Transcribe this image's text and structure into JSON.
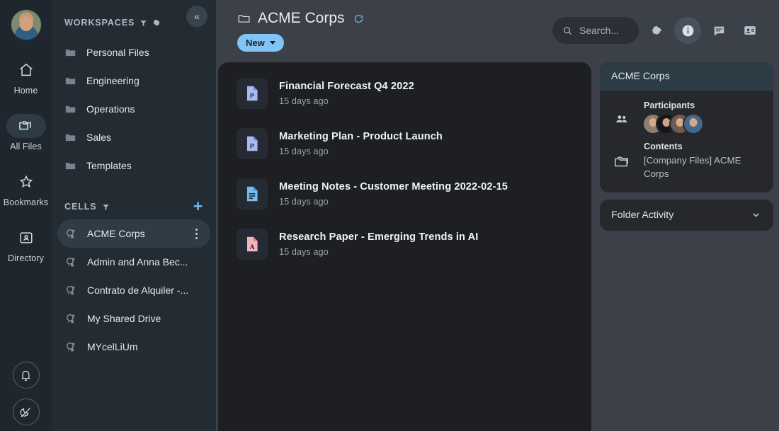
{
  "rail": {
    "avatar_name": "user-avatar",
    "items": [
      {
        "label": "Home",
        "icon": "home-icon"
      },
      {
        "label": "All Files",
        "icon": "files-icon",
        "active": true
      },
      {
        "label": "Bookmarks",
        "icon": "star-icon"
      },
      {
        "label": "Directory",
        "icon": "contact-card-icon"
      }
    ],
    "bottom": [
      {
        "name": "notifications-button",
        "icon": "bell-icon"
      },
      {
        "name": "theme-toggle-button",
        "icon": "magic-wand-icon"
      }
    ]
  },
  "sidebar": {
    "collapse_label": "«",
    "workspaces": {
      "title": "WORKSPACES",
      "filter_icon": "filter-icon",
      "settings_icon": "gear-icon",
      "items": [
        {
          "label": "Personal Files",
          "icon": "personal-folder-icon"
        },
        {
          "label": "Engineering",
          "icon": "folder-icon"
        },
        {
          "label": "Operations",
          "icon": "folder-icon"
        },
        {
          "label": "Sales",
          "icon": "folder-icon"
        },
        {
          "label": "Templates",
          "icon": "folder-icon"
        }
      ]
    },
    "cells": {
      "title": "CELLS",
      "filter_icon": "filter-icon",
      "add_label": "+",
      "items": [
        {
          "label": "ACME Corps",
          "selected": true
        },
        {
          "label": "Admin and Anna Bec..."
        },
        {
          "label": "Contrato de Alquiler -..."
        },
        {
          "label": "My Shared Drive"
        },
        {
          "label": "MYcelLiUm"
        }
      ]
    }
  },
  "header": {
    "folder_icon": "folder-icon",
    "title": "ACME Corps",
    "refresh_icon": "refresh-icon",
    "new_button": "New",
    "search": {
      "placeholder": "Search...",
      "value": "",
      "icon": "search-icon"
    },
    "tools": [
      {
        "name": "settings-button",
        "icon": "gear-icon",
        "active": false
      },
      {
        "name": "info-button",
        "icon": "info-icon",
        "active": true
      },
      {
        "name": "chat-button",
        "icon": "chat-icon",
        "active": false
      },
      {
        "name": "contacts-button",
        "icon": "contact-card-icon",
        "active": false
      }
    ]
  },
  "files": [
    {
      "title": "Financial Forecast Q4 2022",
      "modified": "15 days ago",
      "type": "ppt",
      "color": "#aab9f0"
    },
    {
      "title": "Marketing Plan - Product Launch",
      "modified": "15 days ago",
      "type": "ppt",
      "color": "#aab9f0"
    },
    {
      "title": "Meeting Notes - Customer Meeting 2022-02-15",
      "modified": "15 days ago",
      "type": "doc",
      "color": "#77bdf0"
    },
    {
      "title": "Research Paper - Emerging Trends in AI",
      "modified": "15 days ago",
      "type": "pdf",
      "color": "#f2b3bd"
    }
  ],
  "info_panel": {
    "card_title": "ACME Corps",
    "participants_label": "Participants",
    "participants_icon": "people-icon",
    "participants_count": 4,
    "contents_label": "Contents",
    "contents_icon": "folder-icon",
    "contents_value": "[Company Files] ACME Corps",
    "activity_label": "Folder Activity",
    "activity_chevron": "chevron-down-icon"
  },
  "colors": {
    "accent": "#80c5f5",
    "rail_bg": "#1f262e",
    "sidebar_bg": "#232b33",
    "main_bg": "#3c4049",
    "files_bg": "#1e1f22",
    "card_bg": "#26282c",
    "card_head_bg": "#2d3b45"
  }
}
